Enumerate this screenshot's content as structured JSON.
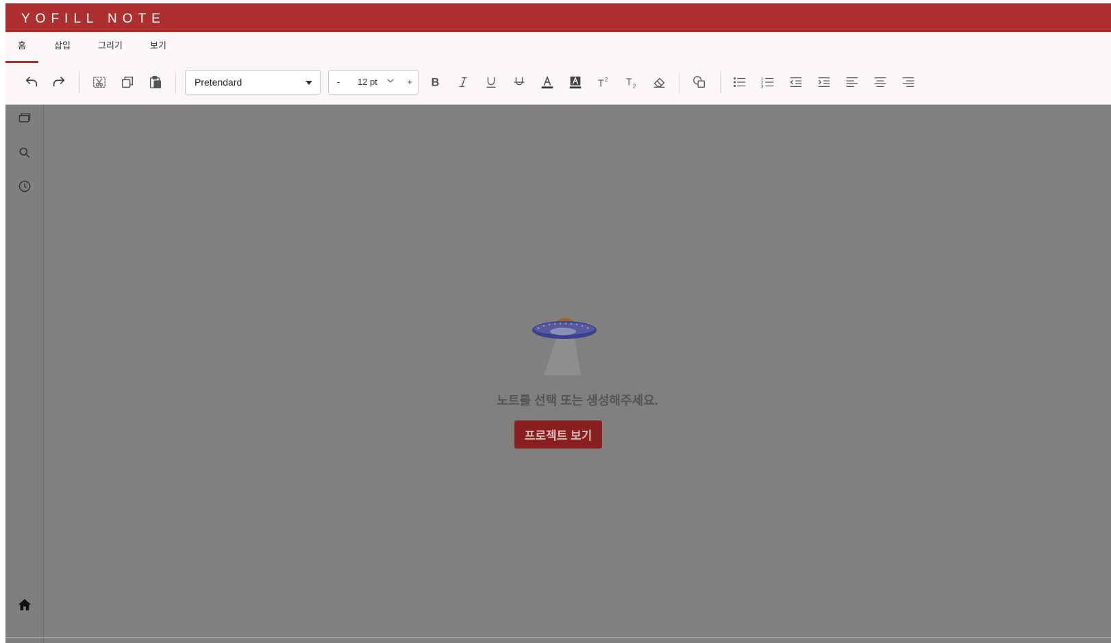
{
  "app": {
    "title": "YOFILL NOTE",
    "brand_color": "#ad2f2f"
  },
  "ribbon": {
    "tabs": [
      {
        "label": "홈",
        "active": true
      },
      {
        "label": "삽입",
        "active": false
      },
      {
        "label": "그리기",
        "active": false
      },
      {
        "label": "보기",
        "active": false
      }
    ]
  },
  "toolbar": {
    "font": {
      "value": "Pretendard"
    },
    "font_size": {
      "minus": "-",
      "value": "12 pt",
      "plus": "+"
    },
    "icons": [
      "undo-icon",
      "redo-icon",
      "cut-icon",
      "copy-icon",
      "paste-icon",
      "bold-icon",
      "italic-icon",
      "underline-icon",
      "strikethrough-icon",
      "font-color-icon",
      "highlight-color-icon",
      "superscript-icon",
      "subscript-icon",
      "clear-format-icon",
      "shape-icon",
      "bullet-list-icon",
      "numbered-list-icon",
      "outdent-icon",
      "indent-icon",
      "align-left-icon",
      "align-center-icon",
      "align-right-icon"
    ]
  },
  "sidebar": {
    "icons": [
      "notebooks-icon",
      "search-icon",
      "history-icon",
      "home-icon"
    ]
  },
  "main": {
    "empty_message": "노트를 선택 또는 생성해주세요.",
    "project_button_label": "프로젝트 보기"
  }
}
